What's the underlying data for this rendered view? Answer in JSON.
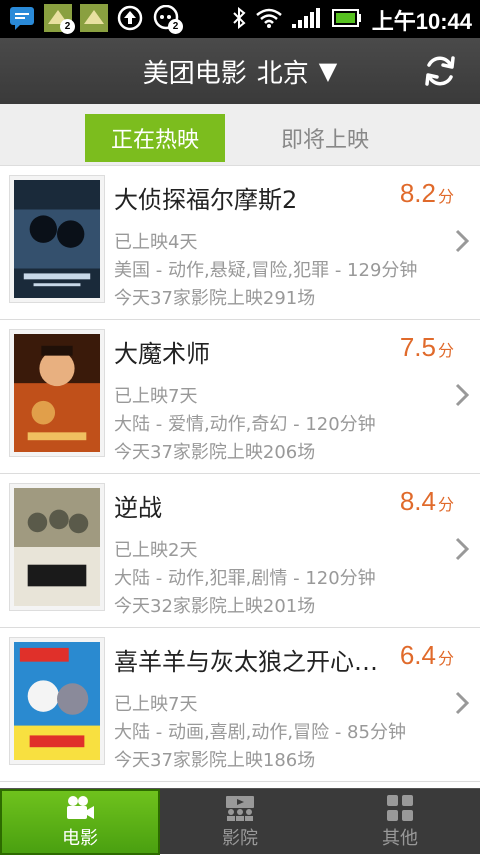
{
  "status_bar": {
    "time": "上午10:44",
    "notification_badges": [
      "2",
      "2"
    ],
    "icons": [
      "chat-notification-icon",
      "app-update-icon",
      "app-update-icon",
      "upload-icon",
      "chat-bubble-icon",
      "bluetooth-icon",
      "wifi-icon",
      "signal-icon",
      "battery-icon"
    ]
  },
  "header": {
    "title": "美团电影",
    "city": "北京",
    "city_caret": "▼",
    "refresh_icon": "refresh-icon"
  },
  "tabs": {
    "now_showing": "正在热映",
    "coming_soon": "即将上映"
  },
  "movies": [
    {
      "title": "大侦探福尔摩斯2",
      "score": "8.2",
      "score_unit": "分",
      "days": "已上映4天",
      "info": "美国 - 动作,悬疑,冒险,犯罪 - 129分钟",
      "cinemas": "今天37家影院上映291场",
      "poster_colors": [
        "#1a2a3a",
        "#3b5a7a",
        "#c8d8e8"
      ]
    },
    {
      "title": "大魔术师",
      "score": "7.5",
      "score_unit": "分",
      "days": "已上映7天",
      "info": "大陆 - 爱情,动作,奇幻 - 120分钟",
      "cinemas": "今天37家影院上映206场",
      "poster_colors": [
        "#3a1a0a",
        "#c0501a",
        "#f0c060"
      ]
    },
    {
      "title": "逆战",
      "score": "8.4",
      "score_unit": "分",
      "days": "已上映2天",
      "info": "大陆 - 动作,犯罪,剧情 - 120分钟",
      "cinemas": "今天32家影院上映201场",
      "poster_colors": [
        "#5a5a4a",
        "#a09a80",
        "#e8e4d8"
      ]
    },
    {
      "title": "喜羊羊与灰太狼之开心闯龙年",
      "score": "6.4",
      "score_unit": "分",
      "days": "已上映7天",
      "info": "大陆 - 动画,喜剧,动作,冒险 - 85分钟",
      "cinemas": "今天37家影院上映186场",
      "poster_colors": [
        "#2a8ad0",
        "#e0302a",
        "#f8e040"
      ]
    }
  ],
  "bottom_nav": {
    "movies": "电影",
    "cinemas": "影院",
    "more": "其他"
  },
  "colors": {
    "accent_green": "#7cbd1e",
    "score_orange": "#e06a2b",
    "header_dark": "#404040"
  }
}
